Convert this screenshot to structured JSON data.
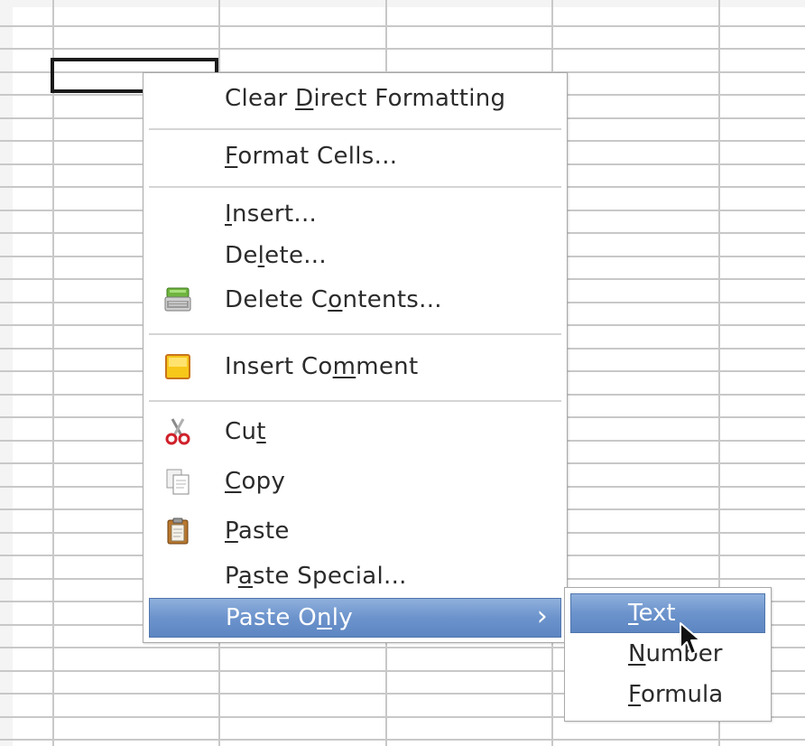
{
  "context_menu": {
    "items": [
      {
        "pre": "Clear ",
        "ul": "D",
        "post": "irect Formatting"
      },
      {
        "pre": "",
        "ul": "F",
        "post": "ormat Cells..."
      },
      {
        "pre": "",
        "ul": "I",
        "post": "nsert..."
      },
      {
        "pre": "De",
        "ul": "l",
        "post": "ete..."
      },
      {
        "pre": "Delete C",
        "ul": "o",
        "post": "ntents..."
      },
      {
        "pre": "Insert Co",
        "ul": "m",
        "post": "ment"
      },
      {
        "pre": "Cu",
        "ul": "t",
        "post": ""
      },
      {
        "pre": "",
        "ul": "C",
        "post": "opy"
      },
      {
        "pre": "",
        "ul": "P",
        "post": "aste"
      },
      {
        "pre": "P",
        "ul": "a",
        "post": "ste Special..."
      },
      {
        "pre": "Paste O",
        "ul": "n",
        "post": "ly",
        "submenu_arrow": "›"
      }
    ]
  },
  "submenu": {
    "items": [
      {
        "pre": "",
        "ul": "T",
        "post": "ext"
      },
      {
        "pre": "",
        "ul": "N",
        "post": "umber"
      },
      {
        "pre": "",
        "ul": "F",
        "post": "ormula"
      }
    ]
  },
  "icons": {
    "delete_contents": "eraser-icon",
    "insert_comment": "comment-note-icon",
    "cut": "scissors-icon",
    "copy": "copy-icon",
    "paste": "clipboard-icon"
  },
  "colors": {
    "highlight": "#6c93cc",
    "grid": "#c8c8c8"
  }
}
